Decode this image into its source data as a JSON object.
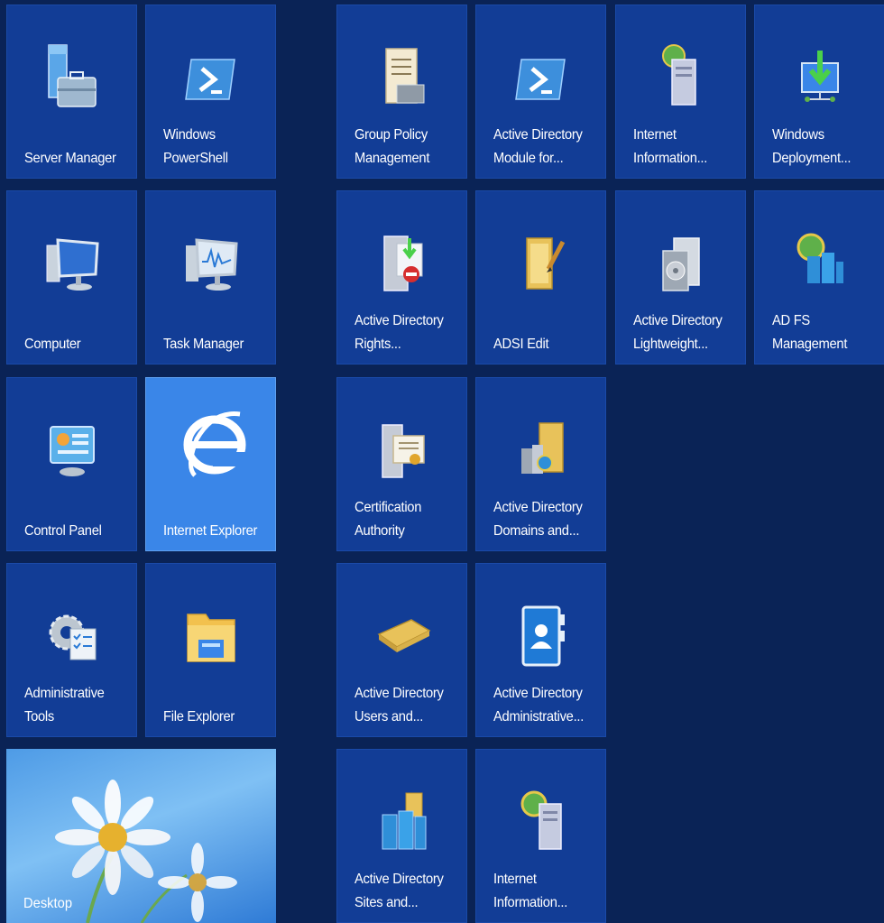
{
  "tiles": {
    "server_manager": {
      "label": "Server Manager",
      "icon": "server-manager-icon"
    },
    "powershell": {
      "label": "Windows\nPowerShell",
      "icon": "powershell-icon"
    },
    "group_policy": {
      "label": "Group Policy\nManagement",
      "icon": "group-policy-icon"
    },
    "ad_module": {
      "label": "Active Directory\nModule for...",
      "icon": "powershell-icon"
    },
    "iis_1": {
      "label": "Internet\nInformation...",
      "icon": "iis-icon"
    },
    "wds": {
      "label": "Windows\nDeployment...",
      "icon": "deployment-icon"
    },
    "computer": {
      "label": "Computer",
      "icon": "computer-icon"
    },
    "task_manager": {
      "label": "Task Manager",
      "icon": "task-manager-icon"
    },
    "ad_rights": {
      "label": "Active Directory\nRights...",
      "icon": "rights-management-icon"
    },
    "adsi_edit": {
      "label": "ADSI Edit",
      "icon": "adsi-edit-icon"
    },
    "ad_lightweight": {
      "label": "Active Directory\nLightweight...",
      "icon": "lightweight-directory-icon"
    },
    "ad_fs": {
      "label": "AD FS\nManagement",
      "icon": "adfs-icon"
    },
    "control_panel": {
      "label": "Control Panel",
      "icon": "control-panel-icon"
    },
    "ie": {
      "label": "Internet Explorer",
      "icon": "internet-explorer-icon"
    },
    "cert_authority": {
      "label": "Certification\nAuthority",
      "icon": "certificate-icon"
    },
    "ad_domains": {
      "label": "Active Directory\nDomains and...",
      "icon": "domains-trusts-icon"
    },
    "admin_tools": {
      "label": "Administrative\nTools",
      "icon": "admin-tools-icon"
    },
    "file_explorer": {
      "label": "File Explorer",
      "icon": "folder-icon"
    },
    "ad_users": {
      "label": "Active Directory\nUsers and...",
      "icon": "users-computers-icon"
    },
    "ad_admin_center": {
      "label": "Active Directory\nAdministrative...",
      "icon": "admin-center-icon"
    },
    "ad_sites": {
      "label": "Active Directory\nSites and...",
      "icon": "sites-services-icon"
    },
    "iis_2": {
      "label": "Internet\nInformation...",
      "icon": "iis-icon"
    },
    "desktop": {
      "label": "Desktop",
      "icon": "desktop-wallpaper"
    }
  },
  "colors": {
    "background": "#0a2356",
    "tile": "#123d96",
    "selected_tile": "#3a86e8"
  }
}
